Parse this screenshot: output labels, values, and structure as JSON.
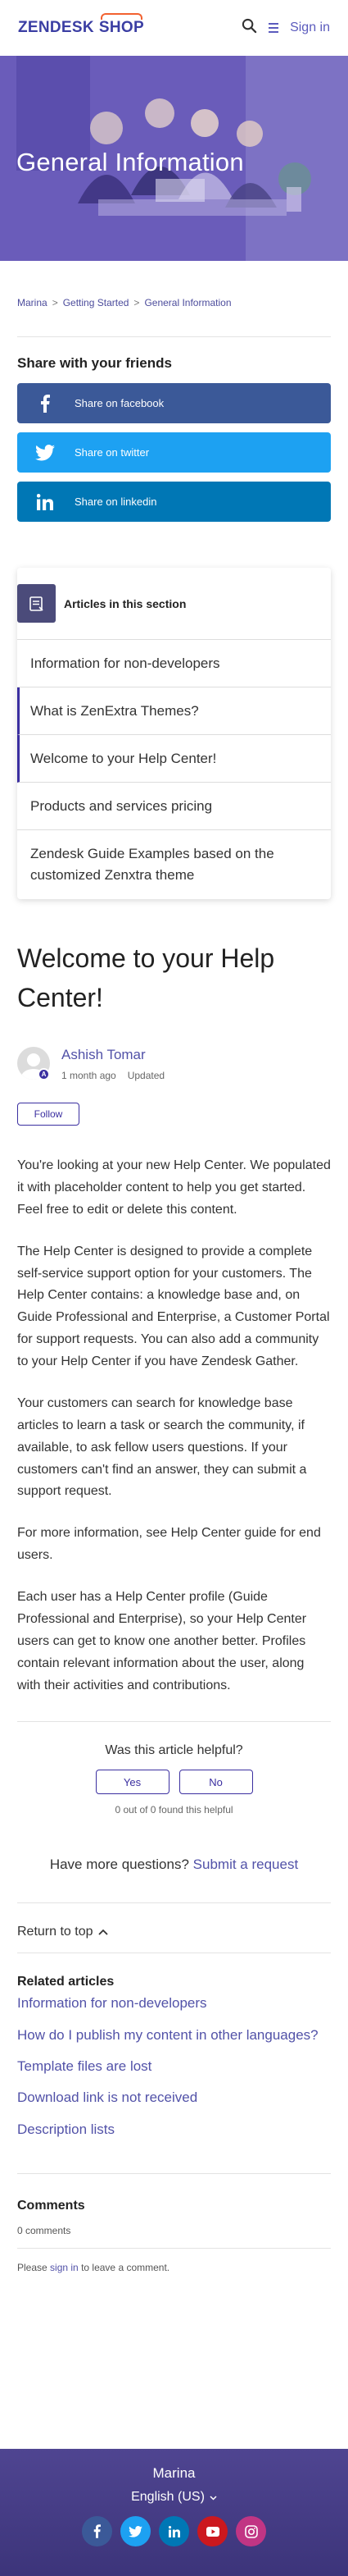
{
  "header": {
    "logo_left": "ZENDESK",
    "logo_right": "SHOP",
    "signin_label": "Sign in",
    "accent": "#3b3ea3",
    "logo_accent": "#f2612f"
  },
  "hero": {
    "title": "General Information"
  },
  "breadcrumb": {
    "items": [
      "Marina",
      "Getting Started",
      "General Information"
    ],
    "separator": ">"
  },
  "share": {
    "title": "Share with your friends",
    "facebook": "Share on facebook",
    "twitter": "Share on twitter",
    "linkedin": "Share on linkedin",
    "colors": {
      "facebook": "#3b5998",
      "twitter": "#1da1f2",
      "linkedin": "#0077b5"
    }
  },
  "section": {
    "heading": "Articles in this section",
    "items": [
      {
        "label": "Information for non-developers"
      },
      {
        "label": "What is ZenExtra Themes?"
      },
      {
        "label": "Welcome to your Help Center!"
      },
      {
        "label": "Products and services pricing"
      },
      {
        "label": "Zendesk Guide Examples based on the customized Zenxtra theme"
      }
    ]
  },
  "article": {
    "title": "Welcome to your Help Center!",
    "author": "Ashish Tomar",
    "time_ago": "1 month ago",
    "updated": "Updated",
    "follow_label": "Follow",
    "paragraphs": [
      "You're looking at your new Help Center. We populated it with placeholder content to help you get started. Feel free to edit or delete this content.",
      "The Help Center is designed to provide a complete self-service support option for your customers. The Help Center contains: a knowledge base and, on Guide Professional and Enterprise, a Customer Portal for support requests. You can also add a community to your Help Center if you have Zendesk Gather.",
      "Your customers can search for knowledge base articles to learn a task or search the community, if available, to ask fellow users questions. If your customers can't find an answer, they can submit a support request.",
      "For more information, see Help Center guide for end users.",
      "Each user has a Help Center profile (Guide Professional and Enterprise), so your Help Center users can get to know one another better. Profiles contain relevant information about the user, along with their activities and contributions."
    ]
  },
  "feedback": {
    "question": "Was this article helpful?",
    "yes": "Yes",
    "no": "No",
    "count_text": "0 out of 0 found this helpful"
  },
  "more_questions": {
    "text": "Have more questions?",
    "link": "Submit a request"
  },
  "return_top": "Return to top",
  "related": {
    "title": "Related articles",
    "items": [
      "Information for non-developers",
      "How do I publish my content in other languages?",
      "Template files are lost",
      "Download link is not received",
      "Description lists"
    ]
  },
  "comments": {
    "title": "Comments",
    "count": "0 comments",
    "please": "Please",
    "signin": "sign in",
    "leave": "to leave a comment."
  },
  "footer": {
    "name": "Marina",
    "language": "English (US)",
    "socials": [
      {
        "name": "facebook-icon",
        "glyph": "f",
        "color": "#3b5998"
      },
      {
        "name": "twitter-icon",
        "glyph": "t",
        "color": "#1da1f2"
      },
      {
        "name": "linkedin-icon",
        "glyph": "in",
        "color": "#0077b5"
      },
      {
        "name": "youtube-icon",
        "glyph": "▶",
        "color": "#cc181e"
      },
      {
        "name": "instagram-icon",
        "glyph": "◎",
        "color": "#c13584"
      }
    ]
  }
}
